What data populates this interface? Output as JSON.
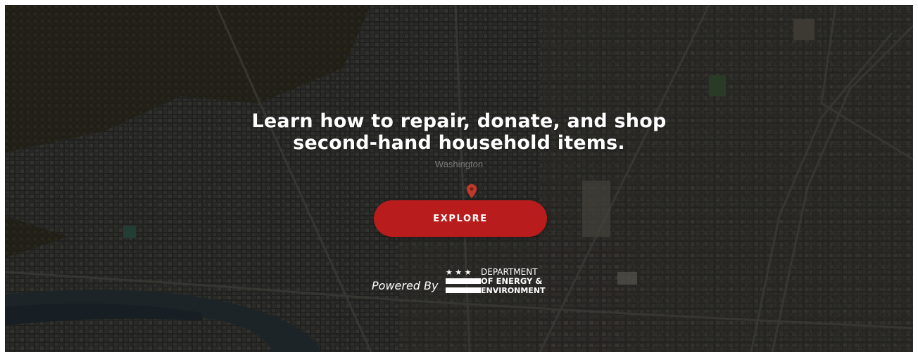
{
  "hero": {
    "headline_line1": "Learn how to repair, donate, and shop",
    "headline_line2": "second-hand household items.",
    "map_label": "Washington",
    "explore_label": "EXPLORE",
    "powered_by": "Powered By"
  },
  "logo": {
    "line1": "DEPARTMENT",
    "line2": "OF ENERGY &",
    "line3": "ENVIRONMENT",
    "stars": "★ ★ ★"
  },
  "colors": {
    "button": "#b91c1c",
    "pin": "#c0392b",
    "text": "#ffffff"
  },
  "icons": [
    "map-pin-icon",
    "dc-flag-icon"
  ]
}
